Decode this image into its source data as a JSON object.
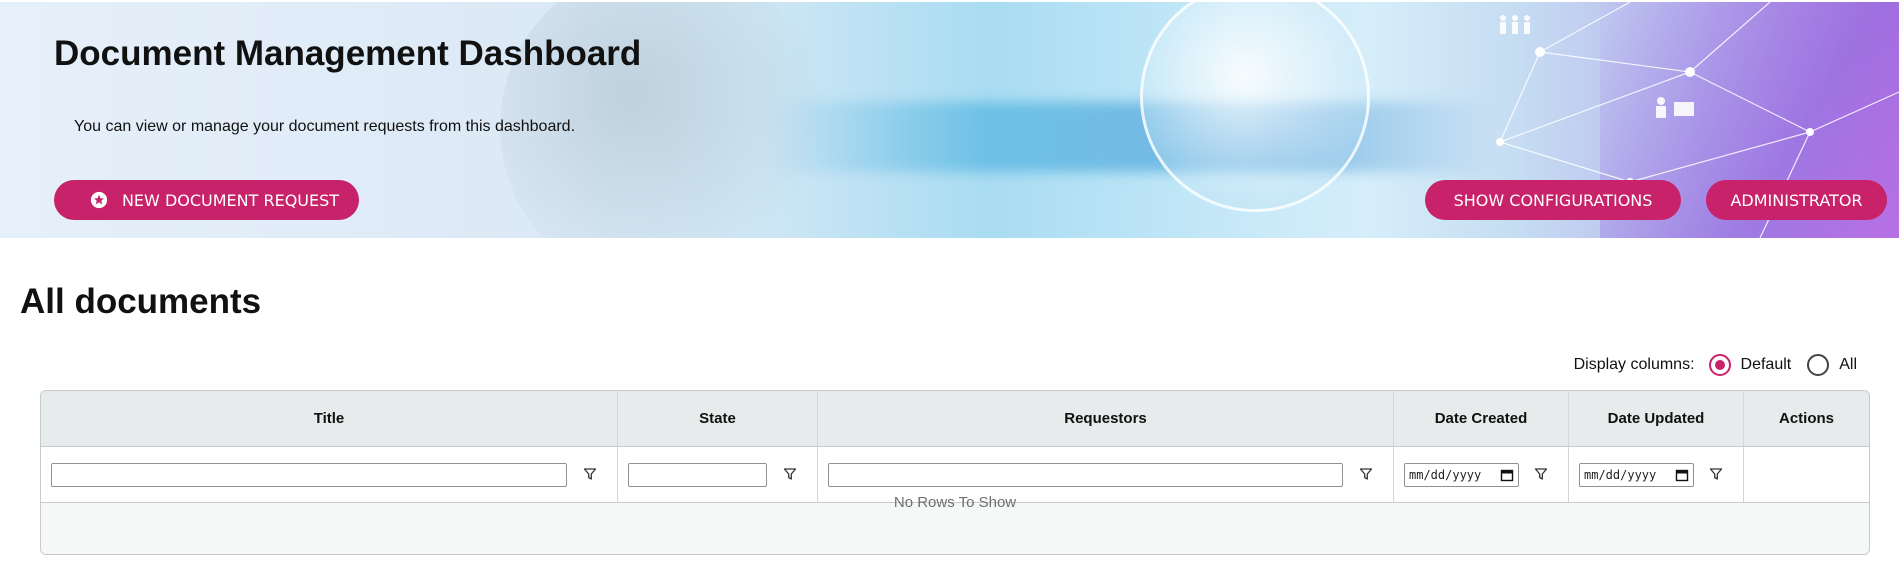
{
  "header": {
    "title": "Document Management Dashboard",
    "subtitle": "You can view or manage your document requests from this dashboard.",
    "buttons": {
      "new_request": "NEW DOCUMENT REQUEST",
      "show_configurations": "SHOW CONFIGURATIONS",
      "administrator": "ADMINISTRATOR"
    }
  },
  "section": {
    "title": "All documents"
  },
  "display_columns": {
    "label": "Display columns:",
    "options": [
      "Default",
      "All"
    ],
    "selected": "Default"
  },
  "grid": {
    "columns": [
      "Title",
      "State",
      "Requestors",
      "Date Created",
      "Date Updated",
      "Actions"
    ],
    "date_placeholder": "mm/dd/yyyy",
    "empty_message": "No Rows To Show"
  },
  "colors": {
    "accent": "#c8226a",
    "header_bg": "#e8ebeb"
  }
}
